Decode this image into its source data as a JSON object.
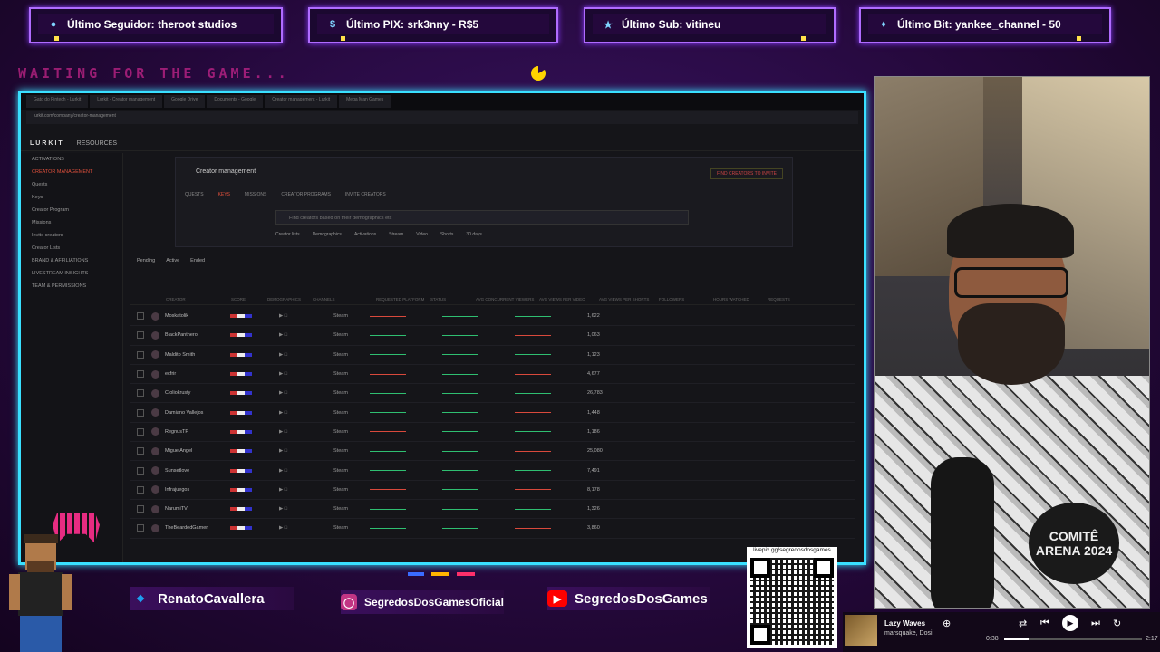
{
  "alerts": [
    {
      "label": "Último Seguidor: theroot studios",
      "icon": "user-icon",
      "icon_color": "#7fd4ff"
    },
    {
      "label": "Último PIX: srk3nny - R$5",
      "icon": "dollar-icon",
      "icon_color": "#7fd4ff"
    },
    {
      "label": "Último Sub: vitineu",
      "icon": "star-icon",
      "icon_color": "#7fd4ff"
    },
    {
      "label": "Último Bit: yankee_channel - 50",
      "icon": "diamond-icon",
      "icon_color": "#7fd4ff"
    }
  ],
  "waiting_text": "WAITING FOR THE GAME...",
  "browser": {
    "tabs": [
      "Gato do Fintech - Lurkit",
      "Lurkit - Creator management",
      "Google Drive",
      "Documents - Google",
      "Creator management - Lurkit",
      "Mega Man Games"
    ],
    "url": "lurkit.com/company/creator-management",
    "app_logo": "LURKIT",
    "app_nav": "RESOURCES",
    "sidebar": [
      {
        "label": "ACTIVATIONS"
      },
      {
        "label": "CREATOR MANAGEMENT",
        "active": true
      },
      {
        "label": "Quests"
      },
      {
        "label": "Keys"
      },
      {
        "label": "Creator Program"
      },
      {
        "label": "Missions"
      },
      {
        "label": "Invite creators"
      },
      {
        "label": "Creator Lists"
      },
      {
        "label": "BRAND & AFFILIATIONS"
      },
      {
        "label": "LIVESTREAM INSIGHTS"
      },
      {
        "label": "TEAM & PERMISSIONS"
      }
    ],
    "card": {
      "title": "Creator management",
      "cta": "FIND CREATORS TO INVITE",
      "tabs": [
        "QUESTS",
        "KEYS",
        "MISSIONS",
        "CREATOR PROGRAMS",
        "INVITE CREATORS"
      ],
      "search_placeholder": "Find creators based on their demographics etc",
      "filters": [
        "Creator lists",
        "Demographics",
        "Activations",
        "Stream",
        "Video",
        "Shorts",
        "30 days"
      ]
    },
    "status_tabs": [
      "Pending",
      "Active",
      "Ended"
    ],
    "columns": [
      "CREATOR",
      "SCORE",
      "DEMOGRAPHICS",
      "CHANNELS",
      "REQUESTED PLATFORM",
      "STATUS",
      "AVG CONCURRENT VIEWERS",
      "AVG VIEWS PER VIDEO",
      "AVG VIEWS PER SHORTS",
      "FOLLOWERS",
      "HOURS WATCHED",
      "REQUESTS",
      "STATUS"
    ],
    "rows": [
      {
        "name": "Moskatolik",
        "platform": "Steam",
        "value": "1,622"
      },
      {
        "name": "BlackPanthero",
        "platform": "Steam",
        "value": "1,063"
      },
      {
        "name": "Maldito Smith",
        "platform": "Steam",
        "value": "1,123"
      },
      {
        "name": "ecfrir",
        "platform": "Steam",
        "value": "4,677"
      },
      {
        "name": "Cloliokrusty",
        "platform": "Steam",
        "value": "26,783"
      },
      {
        "name": "Damiano Vallejos",
        "platform": "Steam",
        "value": "1,448"
      },
      {
        "name": "RegnusTP",
        "platform": "Steam",
        "value": "1,186"
      },
      {
        "name": "MiguelAngel",
        "platform": "Steam",
        "value": "25,080"
      },
      {
        "name": "Sunsetlove",
        "platform": "Steam",
        "value": "7,491"
      },
      {
        "name": "Infrajuegos",
        "platform": "Steam",
        "value": "8,178"
      },
      {
        "name": "NarumiTV",
        "platform": "Steam",
        "value": "1,326"
      },
      {
        "name": "TheBeardedGamer",
        "platform": "Steam",
        "value": "3,860"
      }
    ]
  },
  "socials": [
    {
      "label": "RenatoCavallera",
      "icon": "twitter-icon",
      "color": "#1da1f2"
    },
    {
      "label": "SegredosDosGamesOficial",
      "icon": "instagram-icon",
      "color": "#c13584"
    },
    {
      "label": "SegredosDosGames",
      "icon": "youtube-icon",
      "color": "#ff0000"
    }
  ],
  "qr": {
    "url": "livepix.gg/segredosdosgames"
  },
  "cam": {
    "badge": "COMITÊ ARENA 2024"
  },
  "player": {
    "title": "Lazy Waves",
    "artist": "marsquake, Dosi",
    "current": "0:38",
    "total": "2:17",
    "progress": 0.18
  }
}
